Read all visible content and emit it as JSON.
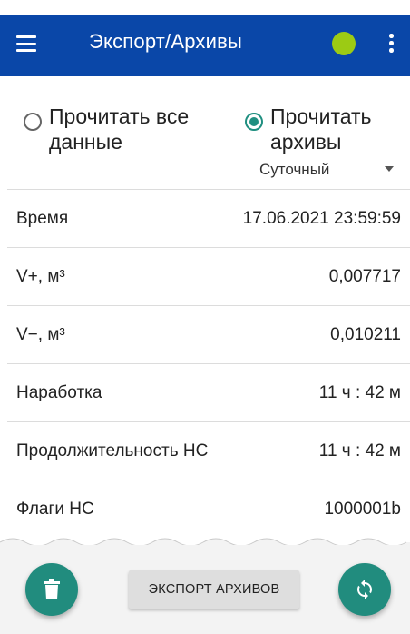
{
  "appbar": {
    "title": "Экспорт/Архивы",
    "status_color": "#9ccb14",
    "menu_icon": "hamburger-menu-icon",
    "overflow_icon": "more-vert-icon"
  },
  "mode": {
    "read_all_label": "Прочитать все данные",
    "read_archives_label": "Прочитать архивы",
    "selected": "read_archives",
    "archive_type": "Суточный"
  },
  "rows": [
    {
      "label": "Время",
      "value": "17.06.2021 23:59:59"
    },
    {
      "label": "V+, м³",
      "value": "0,007717"
    },
    {
      "label": "V−, м³",
      "value": "0,010211"
    },
    {
      "label": "Наработка",
      "value": "11 ч : 42 м"
    },
    {
      "label": "Продолжительность НС",
      "value": "11 ч : 42 м"
    },
    {
      "label": "Флаги НС",
      "value": "1000001b"
    }
  ],
  "bottom": {
    "export_label": "ЭКСПОРТ АРХИВОВ",
    "delete_icon": "trash-icon",
    "sync_icon": "sync-icon"
  },
  "colors": {
    "primary": "#0a47a8",
    "accent": "#218c7e"
  }
}
